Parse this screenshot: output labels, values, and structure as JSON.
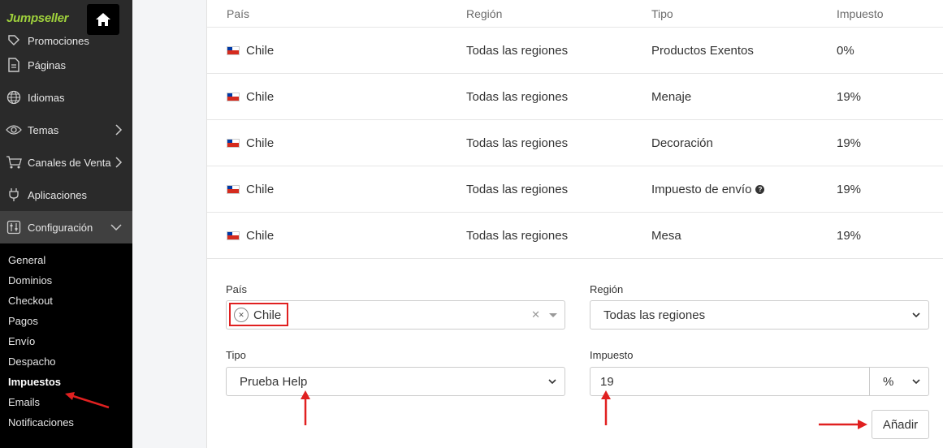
{
  "sidebar": {
    "logo": "Jumpseller",
    "items": [
      {
        "label": "Promociones",
        "icon": "tag-icon"
      },
      {
        "label": "Páginas",
        "icon": "page-icon"
      },
      {
        "label": "Idiomas",
        "icon": "globe-icon"
      },
      {
        "label": "Temas",
        "icon": "eye-icon"
      },
      {
        "label": "Canales de Venta",
        "icon": "cart-icon"
      },
      {
        "label": "Aplicaciones",
        "icon": "plug-icon"
      },
      {
        "label": "Configuración",
        "icon": "settings-icon"
      }
    ],
    "submenu": [
      "General",
      "Dominios",
      "Checkout",
      "Pagos",
      "Envío",
      "Despacho",
      "Impuestos",
      "Emails",
      "Notificaciones"
    ]
  },
  "table": {
    "headers": [
      "País",
      "Región",
      "Tipo",
      "Impuesto"
    ],
    "rows": [
      {
        "pais": "Chile",
        "region": "Todas las regiones",
        "tipo": "Productos Exentos",
        "impuesto": "0%"
      },
      {
        "pais": "Chile",
        "region": "Todas las regiones",
        "tipo": "Menaje",
        "impuesto": "19%"
      },
      {
        "pais": "Chile",
        "region": "Todas las regiones",
        "tipo": "Decoración",
        "impuesto": "19%"
      },
      {
        "pais": "Chile",
        "region": "Todas las regiones",
        "tipo": "Impuesto de envío",
        "impuesto": "19%",
        "help": true
      },
      {
        "pais": "Chile",
        "region": "Todas las regiones",
        "tipo": "Mesa",
        "impuesto": "19%"
      }
    ]
  },
  "form": {
    "pais_label": "País",
    "pais_value": "Chile",
    "region_label": "Región",
    "region_value": "Todas las regiones",
    "tipo_label": "Tipo",
    "tipo_value": "Prueba Help",
    "impuesto_label": "Impuesto",
    "impuesto_value": "19",
    "unit_value": "%",
    "add_label": "Añadir"
  },
  "colors": {
    "sidebar_bg": "#2a2a2a",
    "submenu_bg": "#000000",
    "brand_green": "#9fd13c",
    "annotation_red": "#e02020"
  }
}
